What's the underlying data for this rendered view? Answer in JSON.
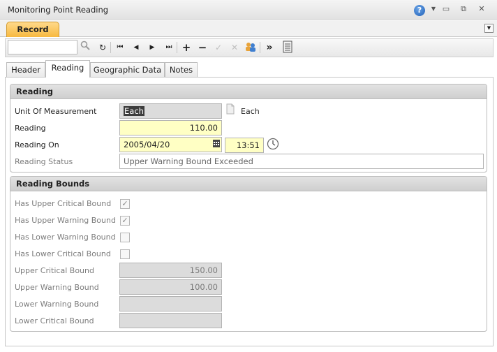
{
  "window": {
    "title": "Monitoring Point Reading"
  },
  "record_tab": "Record",
  "toolbar": {
    "search_value": "",
    "icons": [
      "search-icon",
      "refresh-icon",
      "first-record-icon",
      "previous-record-icon",
      "next-record-icon",
      "last-record-icon",
      "add-icon",
      "remove-icon",
      "save-icon",
      "cancel-icon",
      "users-icon",
      "more-icon",
      "notes-icon"
    ]
  },
  "tabs": [
    "Header",
    "Reading",
    "Geographic Data",
    "Notes"
  ],
  "reading": {
    "section_title": "Reading",
    "uom_label": "Unit Of Measurement",
    "uom_value": "Each",
    "uom_display": "Each",
    "reading_label": "Reading",
    "reading_value": "110.00",
    "reading_on_label": "Reading On",
    "reading_on_date": "2005/04/20",
    "reading_on_time": "13:51",
    "status_label": "Reading Status",
    "status_value": "Upper Warning Bound Exceeded"
  },
  "bounds": {
    "section_title": "Reading Bounds",
    "has_upper_critical_label": "Has Upper Critical Bound",
    "has_upper_critical": true,
    "has_upper_warning_label": "Has Upper Warning Bound",
    "has_upper_warning": true,
    "has_lower_warning_label": "Has Lower Warning Bound",
    "has_lower_warning": false,
    "has_lower_critical_label": "Has Lower Critical Bound",
    "has_lower_critical": false,
    "upper_critical_label": "Upper Critical Bound",
    "upper_critical_value": "150.00",
    "upper_warning_label": "Upper Warning Bound",
    "upper_warning_value": "100.00",
    "lower_warning_label": "Lower Warning Bound",
    "lower_warning_value": "",
    "lower_critical_label": "Lower Critical Bound",
    "lower_critical_value": ""
  },
  "colors": {
    "active_tab": "#f7b940",
    "required_field": "#ffffc4",
    "readonly_field": "#dcdcdc"
  }
}
